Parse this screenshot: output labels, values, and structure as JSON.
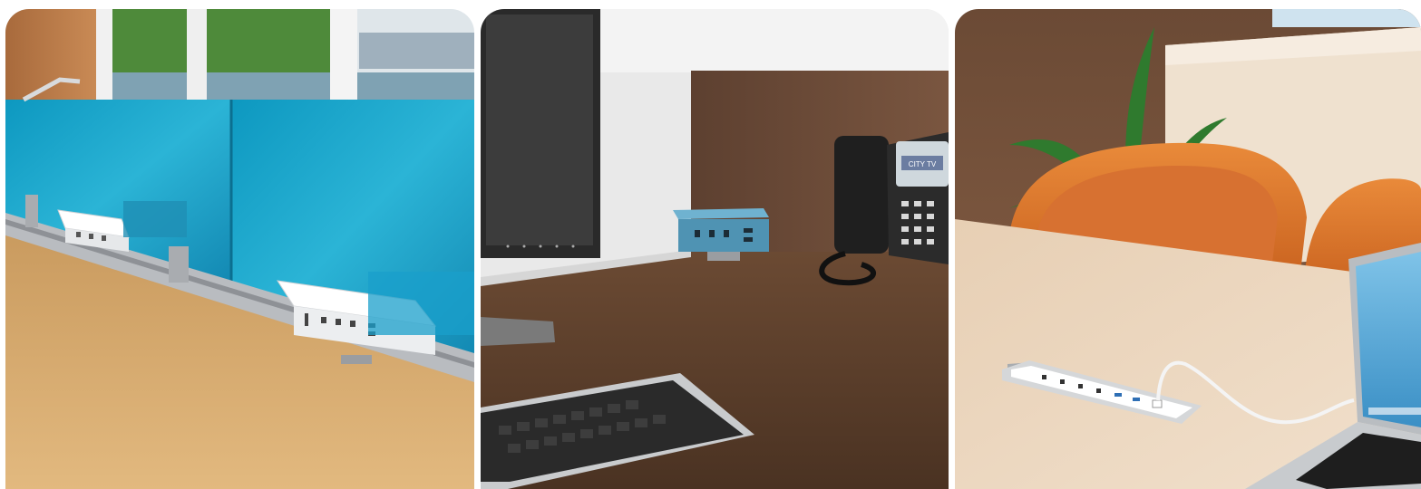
{
  "panels": [
    {
      "scene": "desk-screen-power-units"
    },
    {
      "scene": "desk-back-mounted-power-unit"
    },
    {
      "scene": "table-inset-power-grommet"
    }
  ],
  "colors": {
    "wood_light": "#d9b27a",
    "glass_blue": "#1aa7c9",
    "wood_dark": "#5a3f2c",
    "teal_unit": "#4f93b3",
    "orange_chair": "#e07a2c",
    "table_light": "#ead6bf"
  },
  "phone": {
    "screen_text": "CITY TV"
  }
}
